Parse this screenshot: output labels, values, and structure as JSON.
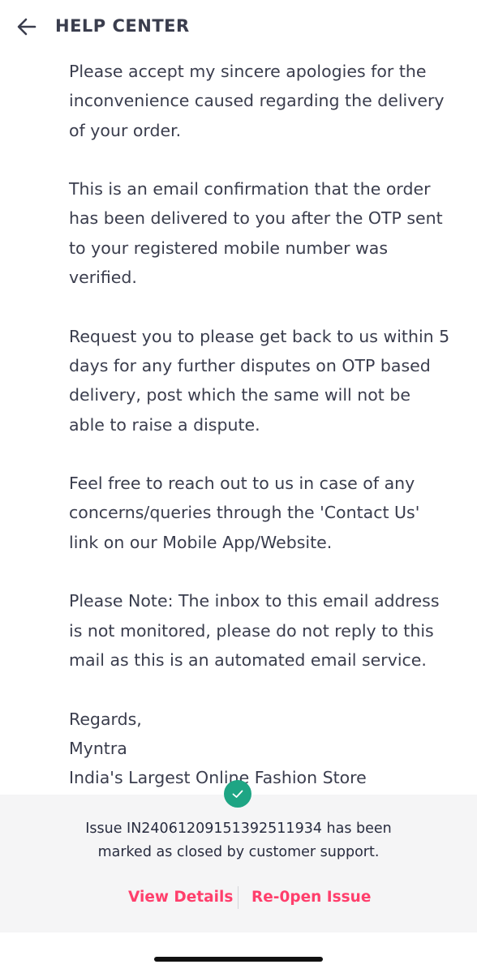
{
  "header": {
    "title": "HELP CENTER",
    "back_icon": "arrow-left-icon"
  },
  "message": {
    "p1": "Please accept my sincere apologies for the inconvenience caused regarding the delivery of your order.",
    "p2": "This is an email confirmation that the order has been delivered to you after the OTP sent to your registered mobile number was verified.",
    "p3": "Request you to please get back to us within 5 days for any further disputes on OTP based delivery, post which the same will not be able to raise a dispute.",
    "p4": "Feel free to reach out to us in case of any concerns/queries through the 'Contact Us' link on our Mobile App/Website.",
    "p5": "Please Note: The inbox to this email address is not monitored, please do not reply to this mail as this is an automated email service.",
    "sign_off": "Regards,",
    "brand": "Myntra",
    "tagline": "India's Largest Online Fashion Store"
  },
  "banner": {
    "status_icon": "check-circle-icon",
    "line1": "Issue IN24061209151392511934 has been",
    "line2": "marked as closed by customer support.",
    "view_details": "View Details",
    "reopen": "Re-0pen Issue"
  },
  "colors": {
    "accent": "#ff3f6c",
    "success": "#1ea584",
    "text": "#3a3d4d",
    "banner_bg": "#f5f5f6"
  }
}
